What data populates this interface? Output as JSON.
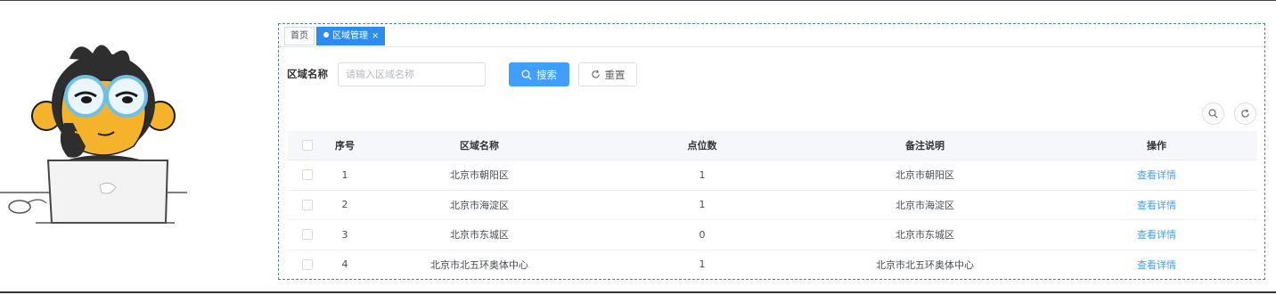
{
  "tabs": {
    "home": "首页",
    "active": "区域管理",
    "close": "×"
  },
  "search": {
    "label": "区域名称",
    "placeholder": "请输入区域名称",
    "search_button": "搜索",
    "reset_button": "重置"
  },
  "table": {
    "headers": [
      "序号",
      "区域名称",
      "点位数",
      "备注说明",
      "操作"
    ],
    "rows": [
      {
        "index": "1",
        "name": "北京市朝阳区",
        "points": "1",
        "remark": "北京市朝阳区",
        "action": "查看详情"
      },
      {
        "index": "2",
        "name": "北京市海淀区",
        "points": "1",
        "remark": "北京市海淀区",
        "action": "查看详情"
      },
      {
        "index": "3",
        "name": "北京市东城区",
        "points": "0",
        "remark": "北京市东城区",
        "action": "查看详情"
      },
      {
        "index": "4",
        "name": "北京市北五环奥体中心",
        "points": "1",
        "remark": "北京市北五环奥体中心",
        "action": "查看详情"
      }
    ]
  },
  "icons": {
    "search_button_icon": "search-icon",
    "reset_button_icon": "refresh-icon",
    "toolbar_search": "search-icon",
    "toolbar_refresh": "refresh-icon"
  },
  "colors": {
    "primary": "#409eff",
    "tab_active": "#2d8cf0",
    "frame_border": "#5d7fae",
    "mascot_body": "#2e2e2e",
    "mascot_face": "#f5b32c"
  }
}
